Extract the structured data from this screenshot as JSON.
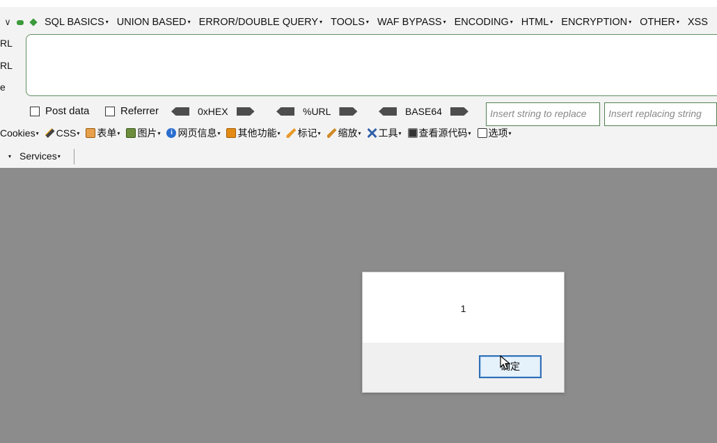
{
  "hackbar": {
    "menus": [
      "SQL BASICS",
      "UNION BASED",
      "ERROR/DOUBLE QUERY",
      "TOOLS",
      "WAF BYPASS",
      "ENCODING",
      "HTML",
      "ENCRYPTION",
      "OTHER",
      "XSS"
    ],
    "side_labels": [
      "RL",
      "RL",
      "e"
    ],
    "url_value": "",
    "post_data_label": "Post data",
    "post_data_checked": false,
    "referrer_label": "Referrer",
    "referrer_checked": false,
    "encoders": [
      "0xHEX",
      "%URL",
      "BASE64"
    ],
    "replace_placeholder": "Insert string to replace",
    "replacing_placeholder": "Insert replacing string"
  },
  "webdev_toolbar": {
    "items": [
      {
        "label": "Cookies",
        "icon": "cookie-icon"
      },
      {
        "label": "CSS",
        "icon": "magic-wand-icon"
      },
      {
        "label": "表单",
        "icon": "form-icon"
      },
      {
        "label": "图片",
        "icon": "image-icon"
      },
      {
        "label": "网页信息",
        "icon": "info-icon"
      },
      {
        "label": "其他功能",
        "icon": "misc-icon"
      },
      {
        "label": "标记",
        "icon": "pencil-icon"
      },
      {
        "label": "缩放",
        "icon": "resize-icon"
      },
      {
        "label": "工具",
        "icon": "tools-icon"
      },
      {
        "label": "查看源代码",
        "icon": "source-icon"
      },
      {
        "label": "选项",
        "icon": "options-icon"
      }
    ]
  },
  "services": {
    "label": "Services"
  },
  "alert": {
    "message": "1",
    "ok_label": "确定"
  },
  "colors": {
    "page_background": "#8c8c8c",
    "toolbar_background": "#f3f3f3",
    "accent_green": "#3c9a3c",
    "dialog_button_border": "#2f6fb6"
  }
}
